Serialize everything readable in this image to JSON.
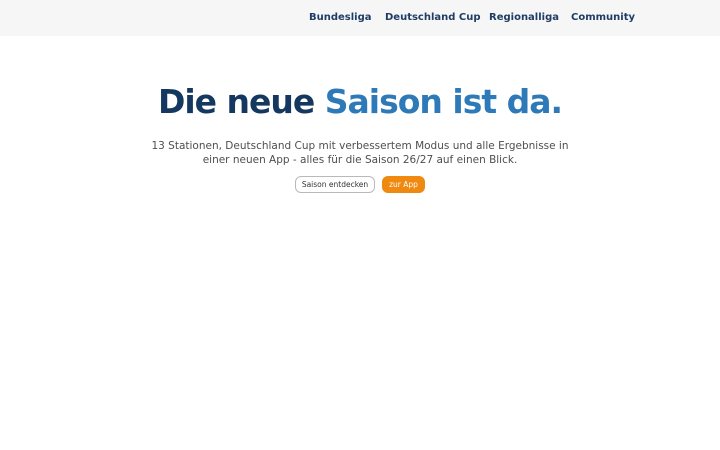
{
  "nav": {
    "items": [
      {
        "label": "Bundesliga"
      },
      {
        "label": "Deutschland Cup"
      },
      {
        "label": "Regionalliga"
      },
      {
        "label": "Community"
      }
    ]
  },
  "hero": {
    "headline_part_a": "Die neue",
    "headline_part_b": "Saison ist da.",
    "subtitle": "13 Stationen, Deutschland Cup mit verbessertem Modus und alle Ergebnisse in einer neuen App - alles für die Saison 26/27 auf einen Blick.",
    "secondary_button": "Saison entdecken",
    "primary_button": "zur App"
  },
  "colors": {
    "nav_text": "#1f3c64",
    "headline_dark": "#14385f",
    "headline_accent": "#2e79b8",
    "primary_button": "#f0890f",
    "topbar_bg": "#f6f6f7"
  }
}
